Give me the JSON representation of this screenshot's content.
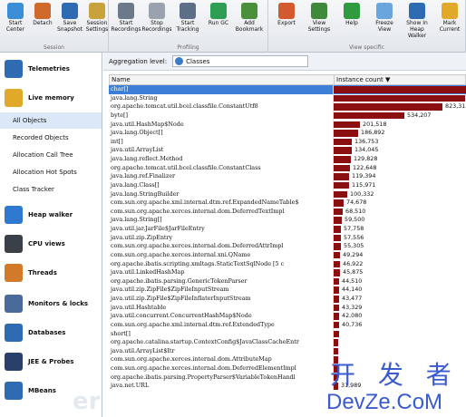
{
  "toolbar": {
    "groups": [
      {
        "label": "Session",
        "buttons": [
          {
            "label": "Start\nCenter",
            "icon": "start-center-icon"
          },
          {
            "label": "Detach",
            "icon": "detach-icon"
          },
          {
            "label": "Save\nSnapshot",
            "icon": "save-snapshot-icon"
          },
          {
            "label": "Session\nSettings",
            "icon": "session-settings-icon"
          }
        ]
      },
      {
        "label": "Profiling",
        "buttons": [
          {
            "label": "Start\nRecordings",
            "icon": "start-recordings-icon"
          },
          {
            "label": "Stop\nRecordings",
            "icon": "stop-recordings-icon"
          },
          {
            "label": "Start\nTracking",
            "icon": "start-tracking-icon"
          },
          {
            "label": "Run GC",
            "icon": "run-gc-icon"
          },
          {
            "label": "Add\nBookmark",
            "icon": "add-bookmark-icon"
          }
        ]
      },
      {
        "label": "View specific",
        "buttons": [
          {
            "label": "Export",
            "icon": "export-icon"
          },
          {
            "label": "View\nSettings",
            "icon": "view-settings-icon"
          },
          {
            "label": "Help",
            "icon": "help-icon"
          },
          {
            "label": "Freeze\nView",
            "icon": "freeze-view-icon"
          },
          {
            "label": "Show In\nHeap Walker",
            "icon": "show-in-heap-walker-icon"
          },
          {
            "label": "Mark\nCurrent",
            "icon": "mark-current-icon"
          }
        ]
      }
    ]
  },
  "sidebar": {
    "items": [
      {
        "label": "Telemetries",
        "icon": "telemetries-icon"
      },
      {
        "label": "Live memory",
        "icon": "live-memory-icon"
      },
      {
        "label": "Heap walker",
        "icon": "heap-walker-icon"
      },
      {
        "label": "CPU views",
        "icon": "cpu-views-icon"
      },
      {
        "label": "Threads",
        "icon": "threads-icon"
      },
      {
        "label": "Monitors & locks",
        "icon": "monitors-locks-icon"
      },
      {
        "label": "Databases",
        "icon": "databases-icon"
      },
      {
        "label": "JEE & Probes",
        "icon": "jee-probes-icon"
      },
      {
        "label": "MBeans",
        "icon": "mbeans-icon"
      }
    ],
    "subitems": [
      "All Objects",
      "Recorded Objects",
      "Allocation Call Tree",
      "Allocation Hot Spots",
      "Class Tracker"
    ],
    "selected_subitem": "All Objects"
  },
  "aggregation": {
    "label": "Aggregation level:",
    "value": "Classes"
  },
  "table": {
    "headers": {
      "name": "Name",
      "count": "Instance count ▼"
    },
    "rows": [
      {
        "name": "char[]",
        "count": 1000000,
        "count_label": ""
      },
      {
        "name": "java.lang.String",
        "count": 995000,
        "count_label": ""
      },
      {
        "name": "org.apache.tomcat.util.bcel.classfile.ConstantUtf8",
        "count": 823312,
        "count_label": "823,312"
      },
      {
        "name": "byte[]",
        "count": 534207,
        "count_label": "534,207"
      },
      {
        "name": "java.util.HashMap$Node",
        "count": 201518,
        "count_label": "201,518"
      },
      {
        "name": "java.lang.Object[]",
        "count": 186892,
        "count_label": "186,892"
      },
      {
        "name": "int[]",
        "count": 136753,
        "count_label": "136,753"
      },
      {
        "name": "java.util.ArrayList",
        "count": 134045,
        "count_label": "134,045"
      },
      {
        "name": "java.lang.reflect.Method",
        "count": 129828,
        "count_label": "129,828"
      },
      {
        "name": "org.apache.tomcat.util.bcel.classfile.ConstantClass",
        "count": 122648,
        "count_label": "122,648"
      },
      {
        "name": "java.lang.ref.Finalizer",
        "count": 119394,
        "count_label": "119,394"
      },
      {
        "name": "java.lang.Class[]",
        "count": 115971,
        "count_label": "115,971"
      },
      {
        "name": "java.lang.StringBuilder",
        "count": 100332,
        "count_label": "100,332"
      },
      {
        "name": "com.sun.org.apache.xml.internal.dtm.ref.ExpandedNameTable$",
        "count": 74678,
        "count_label": "74,678"
      },
      {
        "name": "com.sun.org.apache.xerces.internal.dom.DeferredTextImpl",
        "count": 68510,
        "count_label": "68,510"
      },
      {
        "name": "java.lang.String[]",
        "count": 59500,
        "count_label": "59,500"
      },
      {
        "name": "java.util.jar.JarFile$JarFileEntry",
        "count": 57758,
        "count_label": "57,758"
      },
      {
        "name": "java.util.zip.ZipEntry",
        "count": 57556,
        "count_label": "57,556"
      },
      {
        "name": "com.sun.org.apache.xerces.internal.dom.DeferredAttrImpl",
        "count": 55305,
        "count_label": "55,305"
      },
      {
        "name": "com.sun.org.apache.xerces.internal.xni.QName",
        "count": 49294,
        "count_label": "49,294"
      },
      {
        "name": "org.apache.ibatis.scripting.xmltags.StaticTextSqlNode [5 c",
        "count": 46922,
        "count_label": "46,922"
      },
      {
        "name": "java.util.LinkedHashMap",
        "count": 45875,
        "count_label": "45,875"
      },
      {
        "name": "org.apache.ibatis.parsing.GenericTokenParser",
        "count": 44510,
        "count_label": "44,510"
      },
      {
        "name": "java.util.zip.ZipFile$ZipFileInputStream",
        "count": 44140,
        "count_label": "44,140"
      },
      {
        "name": "java.util.zip.ZipFile$ZipFileInflaterInputStream",
        "count": 43477,
        "count_label": "43,477"
      },
      {
        "name": "java.util.Hashtable",
        "count": 43329,
        "count_label": "43,329"
      },
      {
        "name": "java.util.concurrent.ConcurrentHashMap$Node",
        "count": 42080,
        "count_label": "42,080"
      },
      {
        "name": "com.sun.org.apache.xml.internal.dtm.ref.ExtendedType",
        "count": 40736,
        "count_label": "40,736"
      },
      {
        "name": "short[]",
        "count": 39000,
        "count_label": ""
      },
      {
        "name": "org.apache.catalina.startup.ContextConfig$JavaClassCacheEntr",
        "count": 37500,
        "count_label": ""
      },
      {
        "name": "java.util.ArrayList$Itr",
        "count": 36500,
        "count_label": ""
      },
      {
        "name": "com.sun.org.apache.xerces.internal.dom.AttributeMap",
        "count": 35500,
        "count_label": ""
      },
      {
        "name": "com.sun.org.apache.xerces.internal.dom.DeferredElementImpl",
        "count": 34500,
        "count_label": ""
      },
      {
        "name": "org.apache.ibatis.parsing.PropertyParser$VariableTokenHandl",
        "count": 33500,
        "count_label": ""
      },
      {
        "name": "java.net.URL",
        "count": 31989,
        "count_label": "31,989"
      }
    ]
  },
  "watermark": {
    "cn": "开 发 者",
    "en": "DevZe.CoM"
  },
  "colors": {
    "bar": "#8b0e10",
    "selection": "#3d7fd8",
    "sidebar_selection": "#dbe8f7"
  }
}
